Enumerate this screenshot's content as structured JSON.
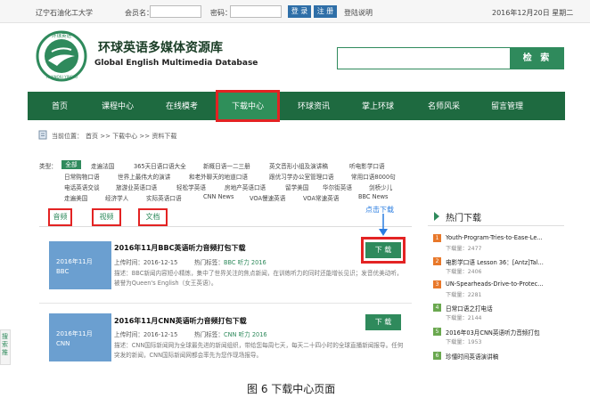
{
  "topbar": {
    "university": "辽宁石油化工大学",
    "member_label": "会员名：",
    "password_label": "密码：",
    "login_button": "登 录",
    "register_button": "注 册",
    "help_link": "登陆说明",
    "date": "2016年12月20日 星期二"
  },
  "header": {
    "logo_text": "环球英语",
    "logo_sub": "HUANQIU YINGYU",
    "title_cn": "环球英语多媒体资源库",
    "title_en": "Global English Multimedia Database",
    "search_placeholder": "",
    "search_button": "检 索"
  },
  "nav": {
    "items": [
      "首页",
      "课程中心",
      "在线模考",
      "下载中心",
      "环球资讯",
      "掌上环球",
      "名师风采",
      "留言管理"
    ],
    "active": "下载中心"
  },
  "breadcrumb": {
    "label": "当前位置：",
    "path": "首页 >> 下载中心 >> 资料下载"
  },
  "categories": {
    "label": "类型：",
    "all": "全部",
    "rows": [
      [
        "走遍法国",
        "365天日语口语大全",
        "新概日语一二三册",
        "英文音形小组及演讲稿",
        "听电影学口语"
      ],
      [
        "日常购物口语",
        "世界上最伟大的演讲",
        "和老外聊天的地道口语",
        "跟优习学办公室管理口语",
        "常用口语8000句"
      ],
      [
        "电话英语交谈",
        "旅游业英语口语",
        "轻松学英语",
        "房地产英语口语",
        "留学美国",
        "华尔街英语",
        "剑桥少儿"
      ],
      [
        "走遍美国",
        "经济学人",
        "实际英语口语",
        "CNN News",
        "VOA慢速英语",
        "VOA常速英语",
        "BBC News"
      ]
    ]
  },
  "tabs": [
    "音频",
    "视频",
    "文档"
  ],
  "annotation": "点击下载",
  "items": [
    {
      "thumb_line1": "2016年11月",
      "thumb_line2": "BBC",
      "title": "2016年11月BBC英语听力音频打包下载",
      "upload_label": "上传时间：",
      "upload_date": "2016-12-15",
      "tag_label": "热门标签：",
      "tag": "BBC 听力 2016",
      "desc": "描述：BBC新闻内容短小精炼，集中了世界关注的焦点新闻，在训练听力的同时还能增长见识；发音优美动听，被誉为Queen's English（女王英语）。",
      "button": "下 载"
    },
    {
      "thumb_line1": "2016年11月",
      "thumb_line2": "CNN",
      "title": "2016年11月CNN英语听力音频打包下载",
      "upload_label": "上传时间：",
      "upload_date": "2016-12-15",
      "tag_label": "热门标签：",
      "tag": "CNN 听力 2016",
      "desc": "描述：CNN国际新闻网为全球最先进的新闻组织，带给您每周七天，每天二十四小时的全球直播新闻报导。任何突发的新闻，CNN国际新闻网都会率先为您作现场报导。",
      "button": "下 载"
    }
  ],
  "hot": {
    "title": "热门下载",
    "items": [
      {
        "num": "1",
        "title": "Youth-Program-Tries-to-Ease-Le...",
        "count": "下载量：2477",
        "color": "#e8782a"
      },
      {
        "num": "2",
        "title": "电影学口语 Lesson 36：[Antz]Tal...",
        "count": "下载量：2406",
        "color": "#e8782a"
      },
      {
        "num": "3",
        "title": "UN-Spearheads-Drive-to-Protec...",
        "count": "下载量：2281",
        "color": "#e8782a"
      },
      {
        "num": "4",
        "title": "日常口语之打电话",
        "count": "下载量：2144",
        "color": "#6aa84f"
      },
      {
        "num": "5",
        "title": "2016年03月CNN英语听力音频打包",
        "count": "下载量：1953",
        "color": "#6aa84f"
      },
      {
        "num": "6",
        "title": "珍懂时间英语演讲稿",
        "count": "",
        "color": "#6aa84f"
      }
    ]
  },
  "floater": "搜索推",
  "caption": "图 6 下载中心页面"
}
